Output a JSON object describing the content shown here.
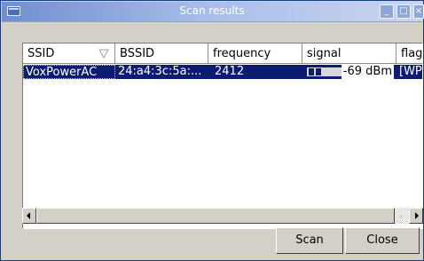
{
  "window": {
    "title": "Scan results",
    "min_glyph": "_",
    "max_glyph": "□",
    "close_glyph": "×"
  },
  "table": {
    "columns": [
      "SSID",
      "BSSID",
      "frequency",
      "signal",
      "flags"
    ],
    "visible_headers": [
      "SSID",
      "BSSID",
      "frequency",
      "signal",
      "flag"
    ],
    "sort_column": "SSID",
    "rows": [
      {
        "ssid": "VoxPowerAC",
        "bssid": "24:a4:3c:5a:...",
        "frequency": "2412",
        "signal_text": "-69 dBm",
        "signal_level": 0.4,
        "flags": "[WP"
      }
    ],
    "selected_row": 0
  },
  "buttons": {
    "scan": "Scan",
    "close": "Close"
  },
  "colors": {
    "selection": "#0c1c70",
    "titlebar": "#6f8fcf",
    "dialog_bg": "#d4d0c8"
  }
}
